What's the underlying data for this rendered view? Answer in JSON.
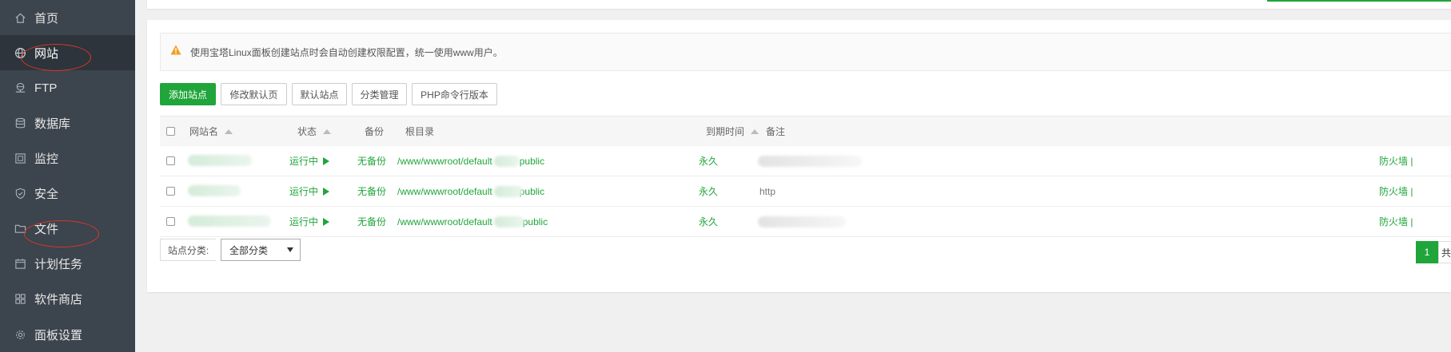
{
  "sidebar": {
    "items": [
      {
        "label": "首页",
        "icon": "home-icon"
      },
      {
        "label": "网站",
        "icon": "globe-icon"
      },
      {
        "label": "FTP",
        "icon": "ftp-icon"
      },
      {
        "label": "数据库",
        "icon": "database-icon"
      },
      {
        "label": "监控",
        "icon": "monitor-icon"
      },
      {
        "label": "安全",
        "icon": "shield-icon"
      },
      {
        "label": "文件",
        "icon": "folder-icon"
      },
      {
        "label": "计划任务",
        "icon": "calendar-icon"
      },
      {
        "label": "软件商店",
        "icon": "apps-grid-icon"
      },
      {
        "label": "面板设置",
        "icon": "gear-icon"
      }
    ],
    "active_index": 1
  },
  "alert": {
    "text": "使用宝塔Linux面板创建站点时会自动创建权限配置，统一使用www用户。",
    "icon": "warning-icon"
  },
  "toolbar": {
    "add_site": "添加站点",
    "modify_default_page": "修改默认页",
    "default_site": "默认站点",
    "category_manage": "分类管理",
    "php_cli_version": "PHP命令行版本"
  },
  "table": {
    "headers": {
      "site_name": "网站名",
      "status": "状态",
      "backup": "备份",
      "root_dir": "根目录",
      "expire_time": "到期时间",
      "note": "备注"
    },
    "rows": [
      {
        "status": "运行中",
        "backup": "无备份",
        "root_prefix": "/www/wwwroot/default",
        "root_suffix": "public",
        "expire": "永久",
        "note": "",
        "actions": "防火墙 | "
      },
      {
        "status": "运行中",
        "backup": "无备份",
        "root_prefix": "/www/wwwroot/default",
        "root_suffix": "public",
        "expire": "永久",
        "note": "http",
        "actions": "防火墙 | "
      },
      {
        "status": "运行中",
        "backup": "无备份",
        "root_prefix": "/www/wwwroot/default",
        "root_suffix": "public",
        "expire": "永久",
        "note": "",
        "actions": "防火墙 | "
      }
    ]
  },
  "footer": {
    "category_label": "站点分类:",
    "category_value": "全部分类",
    "page_current": "1",
    "page_next": "共"
  },
  "colors": {
    "sidebar_bg": "#3c444d",
    "accent_green": "#20a53a",
    "annotation_red": "#d9362b"
  }
}
